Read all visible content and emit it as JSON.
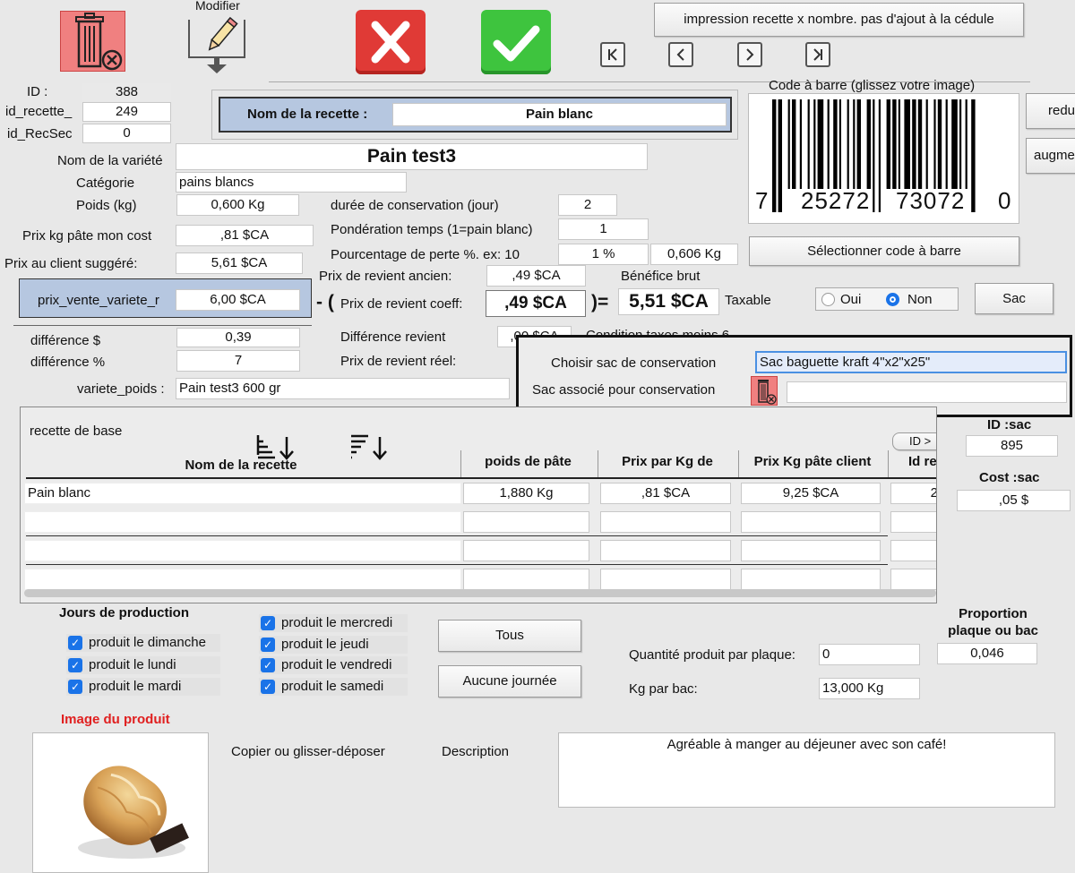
{
  "toolbar": {
    "modify_label": "Modifier",
    "print_button": "impression recette x nombre. pas d'ajout à la cédule",
    "colors": {
      "delete_bg": "#f08080",
      "cancel": "#e03a36",
      "confirm": "#3ec43e"
    },
    "nav": {
      "first": "K",
      "prev": "<",
      "next": ">",
      "last": "K"
    }
  },
  "ids": {
    "id_label": "ID :",
    "id_value": "388",
    "id_recette_label": "id_recette_",
    "id_recette_value": "249",
    "id_recsec_label": "id_RecSec",
    "id_recsec_value": "0"
  },
  "recipe_name": {
    "label": "Nom de la recette :",
    "value": "Pain blanc"
  },
  "barcode": {
    "title": "Code à barre (glissez votre image)",
    "digits": [
      "7",
      "25272",
      "73072",
      "0"
    ],
    "select_button": "Sélectionner code à barre"
  },
  "side_buttons": {
    "reduce": "redu",
    "increase": "augme"
  },
  "variety": {
    "name_label": "Nom de la variété",
    "name_value": "Pain test3",
    "category_label": "Catégorie",
    "category_value": "pains blancs",
    "weight_label": "Poids (kg)",
    "weight_value": "0,600 Kg",
    "cost_label": "Prix kg pâte mon cost",
    "cost_value": ",81 $CA",
    "suggested_label": "Prix au client suggéré:",
    "suggested_value": "5,61 $CA",
    "sale_label": "prix_vente_variete_r",
    "sale_value": "6,00 $CA",
    "diff_dollar_label": "différence $",
    "diff_dollar_value": "0,39",
    "diff_pct_label": "différence %",
    "diff_pct_value": "7",
    "variety_weight_label": "variete_poids :",
    "variety_weight_value": "Pain test3 600 gr"
  },
  "costing": {
    "shelf_life_label": "durée de conservation (jour)",
    "shelf_life_value": "2",
    "time_weight_label": "Pondération temps (1=pain blanc)",
    "time_weight_value": "1",
    "loss_label": "Pourcentage de perte %. ex: 10",
    "loss_value": "1 %",
    "loss_kg_value": "0,606 Kg",
    "old_cost_label": "Prix de revient ancien:",
    "old_cost_value": ",49 $CA",
    "gross_profit_label": "Bénéfice brut",
    "minus_sign": "- (",
    "equals_sign": ")=",
    "coeff_label": "Prix de revient coeff:",
    "coeff_value": ",49 $CA",
    "gross_profit_value": "5,51 $CA",
    "taxable_label": "Taxable",
    "radio_yes": "Oui",
    "radio_no": "Non",
    "radio_selected": "Non",
    "bag_button": "Sac",
    "diff_cost_label": "Différence revient",
    "diff_cost_value": ",00 $CA",
    "tax_condition_label": "Condition taxes moins 6",
    "real_cost_label": "Prix de revient réel:"
  },
  "bag": {
    "choose_label": "Choisir sac de conservation",
    "choose_value": "Sac baguette kraft 4\"x2\"x25\"",
    "associated_label": "Sac associé pour conservation",
    "associated_value": "",
    "id_label": "ID :sac",
    "id_value": "895",
    "cost_label": "Cost :sac",
    "cost_value": ",05 $"
  },
  "recipe_table": {
    "title": "recette de base",
    "id_button": "ID >",
    "columns": [
      "Nom de la recette",
      "poids de pâte",
      "Prix par Kg de",
      "Prix Kg pâte client",
      "Id re"
    ],
    "rows": [
      [
        "Pain blanc",
        "1,880 Kg",
        ",81 $CA",
        "9,25 $CA",
        "2"
      ],
      [
        "",
        "",
        "",
        "",
        ""
      ],
      [
        "",
        "",
        "",
        "",
        ""
      ],
      [
        "",
        "",
        "",
        "",
        ""
      ]
    ]
  },
  "production": {
    "title": "Jours de production",
    "days": [
      {
        "label": "produit le dimanche",
        "checked": true
      },
      {
        "label": "produit le lundi",
        "checked": true
      },
      {
        "label": "produit  le mardi",
        "checked": true
      },
      {
        "label": "produit le mercredi",
        "checked": true
      },
      {
        "label": "produit le jeudi",
        "checked": true
      },
      {
        "label": "produit le vendredi",
        "checked": true
      },
      {
        "label": "produit le samedi",
        "checked": true
      }
    ],
    "all_button": "Tous",
    "none_button": "Aucune journée"
  },
  "quantities": {
    "proportion_label": "Proportion plaque ou bac",
    "proportion_value": "0,046",
    "per_plate_label": "Quantité produit par plaque:",
    "per_plate_value": "0",
    "kg_per_bin_label": "Kg par bac:",
    "kg_per_bin_value": "13,000 Kg"
  },
  "product": {
    "image_label": "Image du produit",
    "copy_label": "Copier ou glisser-déposer",
    "description_label": "Description",
    "description_value": "Agréable à manger au déjeuner avec son café!"
  }
}
